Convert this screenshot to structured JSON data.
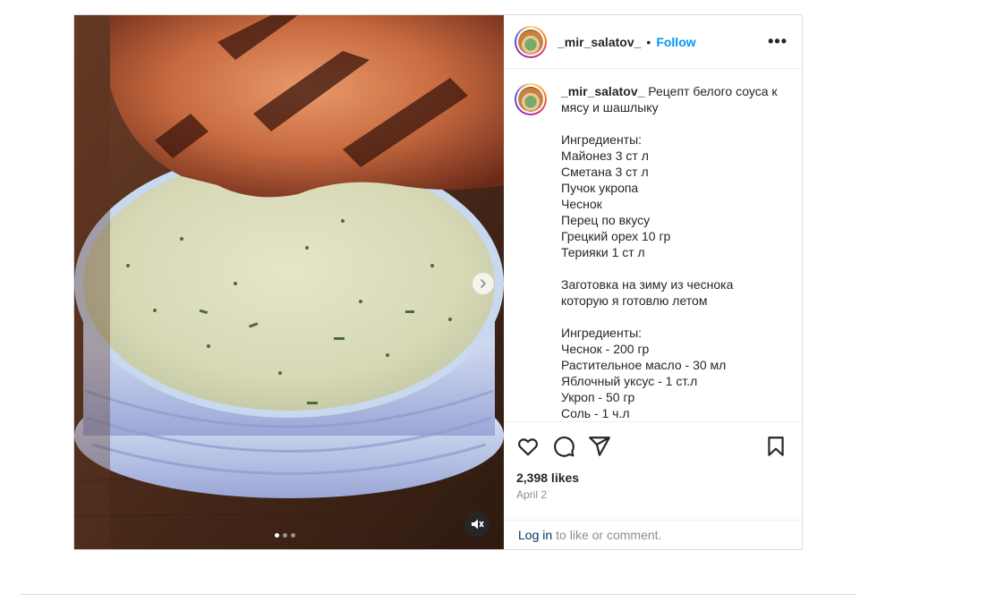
{
  "post": {
    "username": "_mir_salatov_",
    "separator": "•",
    "follow_label": "Follow",
    "more_label": "•••",
    "caption_lines": [
      "Рецепт белого соуса к",
      "мясу и шашлыку",
      "",
      "Ингредиенты:",
      "Майонез 3 ст л",
      "Сметана 3 ст л",
      "Пучок укропа",
      "Чеснок",
      "Перец по вкусу",
      "Грецкий орех 10 гр",
      "Терияки 1 ст л",
      "",
      "Заготовка на зиму из чеснока",
      "которую я готовлю летом",
      "",
      "Ингредиенты:",
      "Чеснок - 200 гр",
      "Растительное масло - 30 мл",
      "Яблочный уксус - 1 ст.л",
      "Укроп - 50 гр",
      "Соль - 1 ч.л"
    ],
    "likes": "2,398 likes",
    "date": "April 2",
    "login_link": "Log in",
    "login_text": "to like or comment.",
    "carousel": {
      "count": 3,
      "active": 0
    },
    "icons": {
      "like": "heart-icon",
      "comment": "comment-icon",
      "share": "share-icon",
      "save": "bookmark-icon",
      "mute": "muted-speaker-icon",
      "next": "chevron-right-icon"
    },
    "colors": {
      "follow": "#0095f6",
      "login": "#00376b"
    }
  }
}
